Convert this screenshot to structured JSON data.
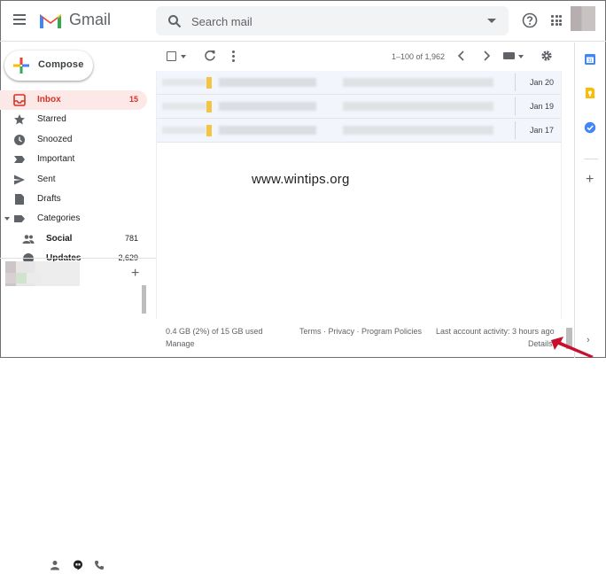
{
  "app": {
    "brand": "Gmail"
  },
  "search": {
    "placeholder": "Search mail"
  },
  "compose": {
    "label": "Compose"
  },
  "nav": {
    "inbox": {
      "label": "Inbox",
      "count": "15"
    },
    "starred": {
      "label": "Starred"
    },
    "snoozed": {
      "label": "Snoozed"
    },
    "important": {
      "label": "Important"
    },
    "sent": {
      "label": "Sent"
    },
    "drafts": {
      "label": "Drafts"
    },
    "categories": {
      "label": "Categories"
    },
    "social": {
      "label": "Social",
      "count": "781"
    },
    "updates": {
      "label": "Updates",
      "count": "2,629"
    }
  },
  "toolbar": {
    "pager": "1–100 of 1,962"
  },
  "emails": [
    {
      "date": "Jan 20"
    },
    {
      "date": "Jan 19"
    },
    {
      "date": "Jan 17"
    }
  ],
  "watermark": "www.wintips.org",
  "footer": {
    "storage": "0.4 GB (2%) of 15 GB used",
    "manage": "Manage",
    "terms": "Terms",
    "dot1": " · ",
    "privacy": "Privacy",
    "dot2": " · ",
    "policies": "Program Policies",
    "activity": "Last account activity: 3 hours ago",
    "details": "Details"
  },
  "colors": {
    "accent_red": "#d93025",
    "inbox_active_bg": "#fce8e6",
    "unread_row_bg": "#f2f6fc",
    "label_tag_yellow": "#f4c542"
  },
  "icons": {
    "header": [
      "menu-icon",
      "gmail-logo",
      "search-icon",
      "help-icon",
      "apps-icon"
    ],
    "rail": [
      "calendar-icon",
      "keep-icon",
      "tasks-icon",
      "add-icon"
    ]
  }
}
